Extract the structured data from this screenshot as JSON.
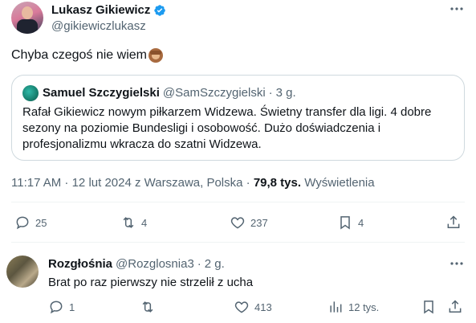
{
  "tweet": {
    "author_name": "Lukasz Gikiewicz",
    "author_handle": "@gikiewiczlukasz",
    "text": "Chyba czegoś nie wiem",
    "emoji_icon": "see-no-evil-monkey-icon",
    "quote": {
      "author_name": "Samuel Szczygielski",
      "author_handle": "@SamSzczygielski",
      "separator": "·",
      "time": "3 g.",
      "text": "Rafał Gikiewicz nowym piłkarzem Widzewa. Świetny transfer dla ligi. 4 dobre sezony na poziomie Bundesligi i osobowość. Dużo doświadczenia i profesjonalizmu wkracza do szatni Widzewa."
    },
    "timestamp": "11:17 AM · 12 lut 2024 z Warszawa, Polska ·",
    "views_count": "79,8 tys.",
    "views_label": "Wyświetlenia",
    "actions": {
      "replies": "25",
      "retweets": "4",
      "likes": "237",
      "bookmarks": "4"
    }
  },
  "reply": {
    "author_name": "Rozgłośnia",
    "author_handle": "@Rozglosnia3",
    "separator": "·",
    "time": "2 g.",
    "text": "Brat po raz pierwszy nie strzelił z ucha",
    "actions": {
      "replies": "1",
      "retweets": "",
      "likes": "413",
      "views": "12 tys."
    }
  },
  "colors": {
    "text_primary": "#0f1419",
    "text_secondary": "#536471",
    "verified_blue": "#1d9bf0",
    "border": "#cfd9de"
  }
}
